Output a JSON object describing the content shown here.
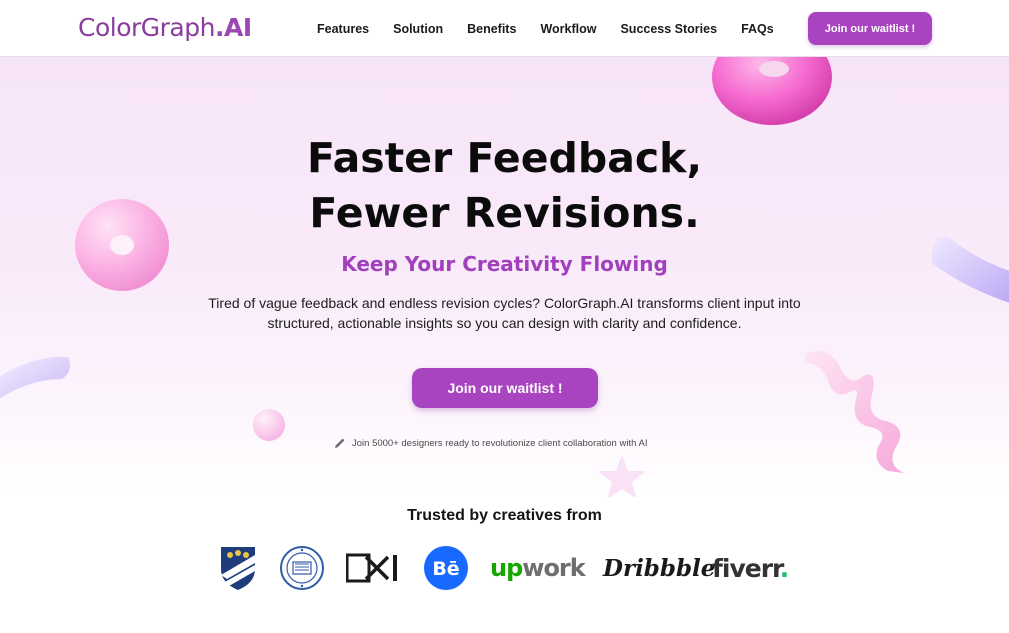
{
  "header": {
    "logo_text": "ColorGraph",
    "logo_suffix": ".AI",
    "nav": [
      "Features",
      "Solution",
      "Benefits",
      "Workflow",
      "Success Stories",
      "FAQs"
    ],
    "cta_label": "Join our waitlist !"
  },
  "hero": {
    "title_line1": "Faster Feedback,",
    "title_line2": "Fewer Revisions.",
    "subtitle": "Keep Your Creativity Flowing",
    "description": "Tired of vague feedback and endless revision cycles? ColorGraph.AI transforms client input into structured, actionable insights so you can design with clarity and confidence.",
    "cta_label": "Join our waitlist !",
    "note": "Join 5000+ designers ready to revolutionize client collaboration with AI"
  },
  "trusted": {
    "heading": "Trusted by creatives from",
    "logos": [
      {
        "name": "shield-crest-icon"
      },
      {
        "name": "university-seal-icon"
      },
      {
        "name": "DXI",
        "text": "D X I"
      },
      {
        "name": "Behance",
        "text": "Bē"
      },
      {
        "name": "Upwork",
        "text": "upwork"
      },
      {
        "name": "Dribbble",
        "text": "Dribbble"
      },
      {
        "name": "Fiverr",
        "text": "fiverr."
      }
    ]
  },
  "colors": {
    "accent": "#a944c0",
    "subtitle": "#a13fbd",
    "upwork_green": "#14a800",
    "behance_blue": "#1769ff",
    "fiverr_green": "#1dbf73"
  }
}
